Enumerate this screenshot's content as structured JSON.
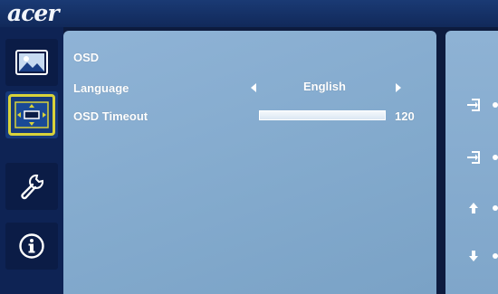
{
  "brand": {
    "name": "acer"
  },
  "sidebar": {
    "items": [
      {
        "icon": "picture-icon",
        "selected": false
      },
      {
        "icon": "osd-position-icon",
        "selected": true
      },
      {
        "icon": "settings-wrench-icon",
        "selected": false
      },
      {
        "icon": "info-icon",
        "selected": false
      }
    ]
  },
  "osd_menu": {
    "title": "OSD",
    "language": {
      "label": "Language",
      "value": "English"
    },
    "timeout": {
      "label": "OSD Timeout",
      "value": "120",
      "slider_fraction": 1.0
    }
  },
  "keys": [
    {
      "icon": "exit-icon"
    },
    {
      "icon": "enter-icon"
    },
    {
      "icon": "arrow-up-icon"
    },
    {
      "icon": "arrow-down-icon"
    }
  ],
  "colors": {
    "panel": "#8fb3d6",
    "sidebar": "#0e2354",
    "selection": "#d8d23a"
  }
}
